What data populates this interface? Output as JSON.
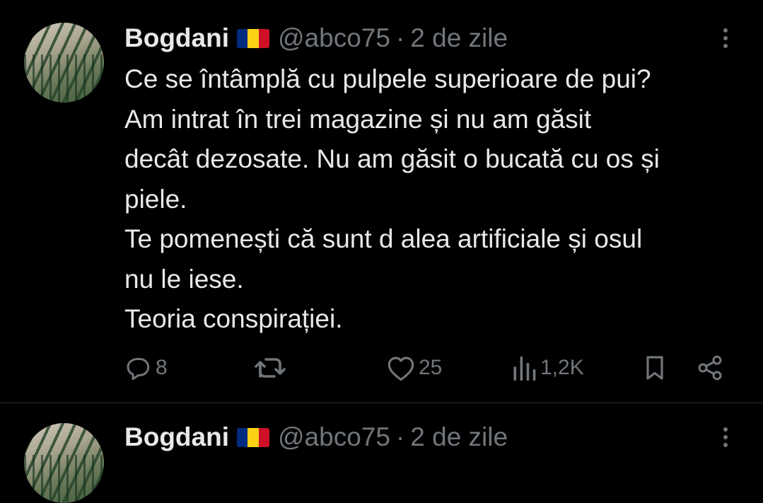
{
  "tweets": [
    {
      "author": "Bogdani",
      "handle": "@abco75",
      "separator": "·",
      "time": "2 de zile",
      "lines": [
        "Ce se întâmplă cu pulpele superioare de pui?",
        "Am intrat în trei magazine și nu am găsit",
        "decât dezosate. Nu am găsit o bucată cu os și",
        "piele.",
        "Te pomenești că sunt d alea artificiale și osul",
        "nu le iese.",
        "Teoria conspirației."
      ],
      "replies": "8",
      "likes": "25",
      "views": "1,2K"
    },
    {
      "author": "Bogdani",
      "handle": "@abco75",
      "separator": "·",
      "time": "2 de zile"
    }
  ],
  "colors": {
    "background": "#000000",
    "text": "#e7e9ea",
    "secondary": "#71767b",
    "divider": "#2f3336",
    "flag": [
      "#002b7f",
      "#fcd116",
      "#ce1126"
    ]
  },
  "icons": {
    "reply": "reply-icon",
    "retweet": "retweet-icon",
    "like": "heart-icon",
    "views": "views-icon",
    "bookmark": "bookmark-icon",
    "share": "share-icon",
    "more": "more-icon",
    "flag": "romania-flag-icon"
  }
}
